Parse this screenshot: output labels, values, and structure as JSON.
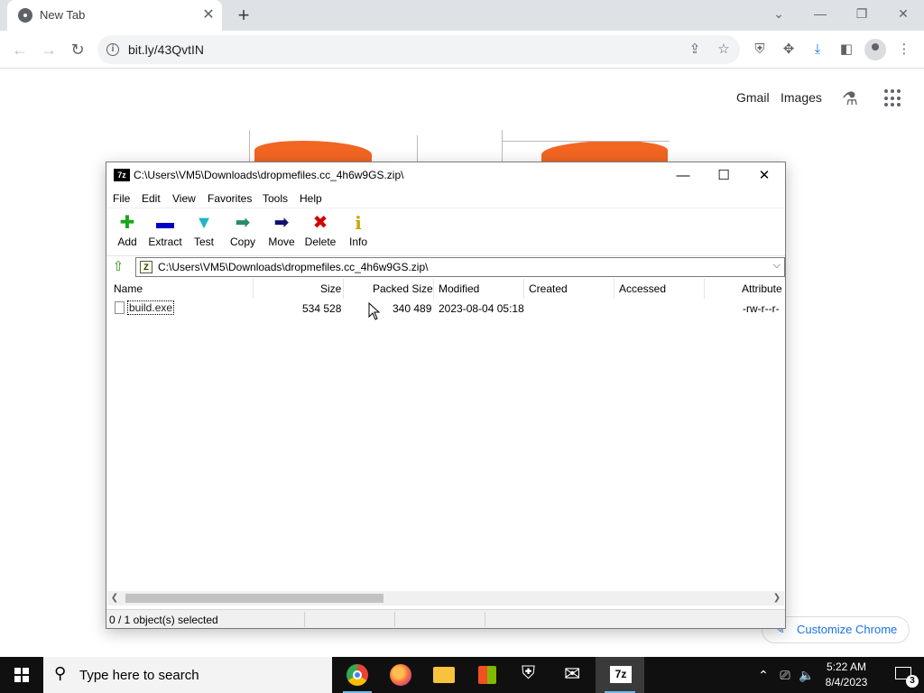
{
  "browser": {
    "tab_title": "New Tab",
    "tab_close": "✕",
    "new_tab": "+",
    "url": "bit.ly/43QvtIN",
    "ntp": {
      "gmail": "Gmail",
      "images": "Images",
      "customize": "Customize Chrome"
    }
  },
  "sevenzip": {
    "title": "C:\\Users\\VM5\\Downloads\\dropmefiles.cc_4h6w9GS.zip\\",
    "app_icon_text": "7z",
    "menu": [
      "File",
      "Edit",
      "View",
      "Favorites",
      "Tools",
      "Help"
    ],
    "toolbar": [
      {
        "label": "Add",
        "icon": "plus-icon",
        "glyph": "✚",
        "color": "#1aa51a"
      },
      {
        "label": "Extract",
        "icon": "minus-icon",
        "glyph": "▬",
        "color": "#0000c8"
      },
      {
        "label": "Test",
        "icon": "check-icon",
        "glyph": "▼",
        "color": "#1fb5c7"
      },
      {
        "label": "Copy",
        "icon": "copy-arrow-icon",
        "glyph": "➡",
        "color": "#2a8a6a"
      },
      {
        "label": "Move",
        "icon": "move-arrow-icon",
        "glyph": "➡",
        "color": "#10106e"
      },
      {
        "label": "Delete",
        "icon": "delete-x-icon",
        "glyph": "✖",
        "color": "#d40000"
      },
      {
        "label": "Info",
        "icon": "info-icon",
        "glyph": "i",
        "color": "#c8a800"
      }
    ],
    "address": "C:\\Users\\VM5\\Downloads\\dropmefiles.cc_4h6w9GS.zip\\",
    "columns": {
      "name": "Name",
      "size": "Size",
      "packed": "Packed Size",
      "modified": "Modified",
      "created": "Created",
      "accessed": "Accessed",
      "attributes": "Attribute"
    },
    "files": [
      {
        "name": "build.exe",
        "size": "534 528",
        "packed": "340 489",
        "modified": "2023-08-04 05:18",
        "created": "",
        "accessed": "",
        "attributes": "-rw-r--r-"
      }
    ],
    "status": "0 / 1 object(s) selected"
  },
  "taskbar": {
    "search_placeholder": "Type here to search",
    "time": "5:22 AM",
    "date": "8/4/2023",
    "notification_count": "3",
    "app_label_7z": "7z"
  }
}
